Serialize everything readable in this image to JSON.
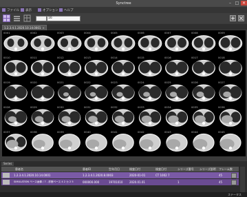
{
  "window": {
    "title": "Synctree"
  },
  "menu": {
    "items": [
      {
        "label": "ファイル"
      },
      {
        "label": "表示"
      },
      {
        "label": "オプション"
      },
      {
        "label": "ヘルプ"
      }
    ]
  },
  "toolbar": {
    "query_value": "16"
  },
  "tab": {
    "label": "1.2.3.4.1.2020.10.14.0001"
  },
  "grid": {
    "labels": [
      "0001",
      "0002",
      "0003",
      "0004",
      "0005",
      "0006",
      "0007",
      "0008",
      "0009",
      "0010",
      "0011",
      "0012",
      "0013",
      "0014",
      "0015",
      "0016",
      "0017",
      "0018",
      "0019",
      "0020",
      "0021",
      "0022",
      "0023",
      "0024",
      "0025",
      "0026",
      "0027",
      "0028",
      "0029",
      "0030",
      "0031",
      "0032",
      "0033",
      "0034",
      "0035",
      "0036",
      "0037",
      "0038",
      "0039",
      "0040",
      "0041",
      "0042",
      "0043",
      "0044",
      "0045"
    ]
  },
  "lower_panel": {
    "tab_label": "Series",
    "columns": [
      "患者名",
      "患者ID",
      "生年月日",
      "検査日付",
      "検査日付",
      "シリーズ番号",
      "シリーズ説明",
      "フレーム数"
    ],
    "rows": [
      [
        "1.2.3.4.1.2020.10.14.0001",
        "1.2.3.4.1.2020.8.0003",
        "",
        "2020-01-01",
        "CT 1002 7",
        "",
        "",
        "45"
      ],
      [
        "SIMULATION ベース画像 / 7 - 診断ベース 4 2 カ 2 5",
        "000000.000",
        "19701010",
        "2020.01.01",
        "",
        "1",
        "",
        "45"
      ]
    ]
  },
  "status": {
    "text": "ステータス"
  }
}
